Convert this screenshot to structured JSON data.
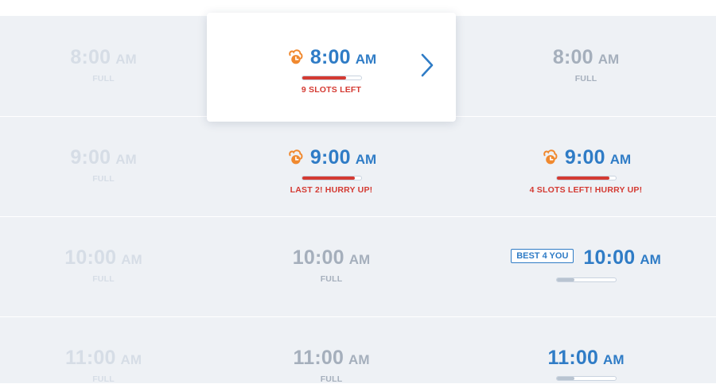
{
  "colors": {
    "accent": "#2f7cc6",
    "urgent": "#d43a32",
    "icon_orange": "#f0892f",
    "full_gray": "#c3cbd6",
    "faded_gray": "#d6dde6",
    "mid_gray": "#a5afbc",
    "bar_gray": "#b9c4d1"
  },
  "slots": [
    {
      "time": "8:00",
      "ampm": "AM",
      "status": "FULL"
    },
    {
      "time": "8:00",
      "ampm": "AM",
      "status": "9 SLOTS LEFT",
      "icon": "urgency-clock-icon",
      "fill": 0.75
    },
    {
      "time": "8:00",
      "ampm": "AM",
      "status": "FULL"
    },
    {
      "time": "9:00",
      "ampm": "AM",
      "status": "FULL"
    },
    {
      "time": "9:00",
      "ampm": "AM",
      "status": "LAST 2! HURRY UP!",
      "icon": "urgency-clock-icon",
      "fill": 0.9
    },
    {
      "time": "9:00",
      "ampm": "AM",
      "status": "4 SLOTS LEFT! HURRY UP!",
      "icon": "urgency-clock-icon",
      "fill": 0.9
    },
    {
      "time": "10:00",
      "ampm": "AM",
      "status": "FULL"
    },
    {
      "time": "10:00",
      "ampm": "AM",
      "status": "FULL"
    },
    {
      "time": "10:00",
      "ampm": "AM",
      "badge": "BEST 4 YOU",
      "fill": 0.3
    },
    {
      "time": "11:00",
      "ampm": "AM",
      "status": "FULL"
    },
    {
      "time": "11:00",
      "ampm": "AM",
      "status": "FULL"
    },
    {
      "time": "11:00",
      "ampm": "AM",
      "fill": 0.3
    }
  ],
  "nav": {
    "next_icon": "chevron-right-icon"
  }
}
